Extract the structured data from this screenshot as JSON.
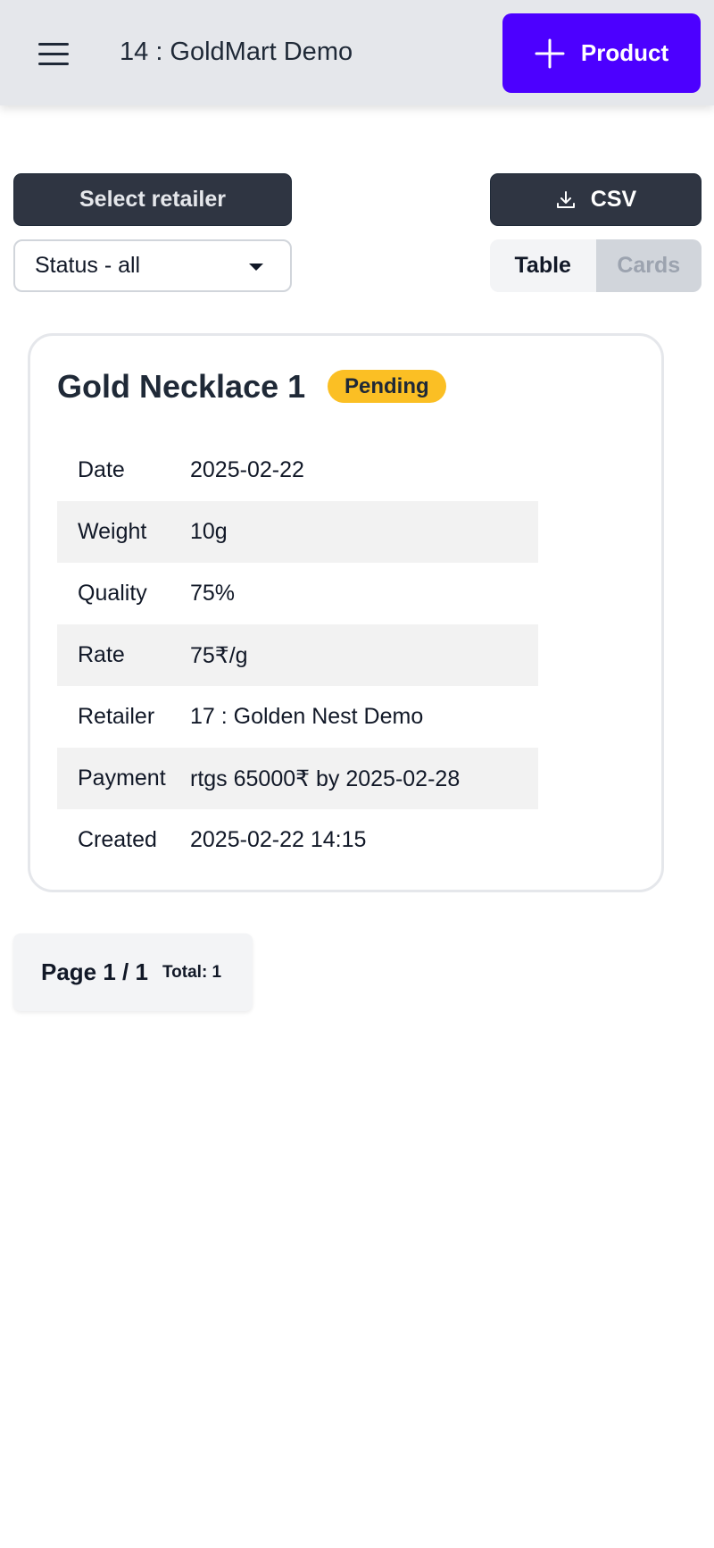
{
  "header": {
    "title": "14 : GoldMart Demo",
    "add_button_label": "Product"
  },
  "toolbar": {
    "select_retailer_label": "Select retailer",
    "csv_label": "CSV",
    "status_select_value": "Status - all",
    "view_toggle": {
      "table_label": "Table",
      "cards_label": "Cards",
      "selected": "Table"
    }
  },
  "card": {
    "title": "Gold Necklace 1",
    "status": "Pending",
    "status_color": "#fbbf24",
    "rows": [
      {
        "label": "Date",
        "value": "2025-02-22"
      },
      {
        "label": "Weight",
        "value": "10g"
      },
      {
        "label": "Quality",
        "value": "75%"
      },
      {
        "label": "Rate",
        "value": "75₹/g"
      },
      {
        "label": "Retailer",
        "value": "17 : Golden Nest Demo"
      },
      {
        "label": "Payment",
        "value": "rtgs 65000₹ by 2025-02-28"
      },
      {
        "label": "Created",
        "value": "2025-02-22 14:15"
      }
    ]
  },
  "pagination": {
    "page_text": "Page 1 / 1",
    "total_text": "Total: 1"
  },
  "colors": {
    "accent": "#4c00ff",
    "dark_button": "#2f3542",
    "header_bg": "#e5e7eb"
  },
  "icons": {
    "menu": "hamburger-menu-icon",
    "add": "plus-icon",
    "download": "download-icon",
    "dropdown": "caret-down-icon"
  }
}
